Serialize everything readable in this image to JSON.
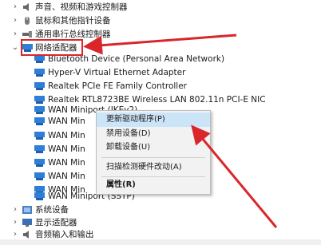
{
  "tree": {
    "top_items": [
      {
        "label": "声音、视频和游戏控制器",
        "icon": "speaker-icon"
      },
      {
        "label": "鼠标和其他指针设备",
        "icon": "mouse-icon"
      },
      {
        "label": "通用串行总线控制器",
        "icon": "usb-icon"
      }
    ],
    "network_adapters": {
      "label": "网络适配器",
      "children": [
        "Bluetooth Device (Personal Area Network)",
        "Hyper-V Virtual Ethernet Adapter",
        "Realtek PCIe FE Family Controller",
        "Realtek RTL8723BE Wireless LAN 802.11n PCI-E NIC",
        "WAN Miniport (IKEv2)",
        "WAN Min",
        "WAN Min",
        "WAN Min",
        "WAN Min",
        "WAN Min",
        "WAN Min",
        "WAN Miniport (SSTP)"
      ]
    },
    "bottom_items": [
      {
        "label": "系统设备",
        "icon": "system-icon"
      },
      {
        "label": "显示适配器",
        "icon": "display-icon"
      },
      {
        "label": "音频输入和输出",
        "icon": "audio-io-icon"
      }
    ]
  },
  "context_menu": {
    "items": [
      "更新驱动程序(P)",
      "禁用设备(D)",
      "卸载设备(U)",
      "扫描检测硬件改动(A)",
      "属性(R)"
    ]
  },
  "colors": {
    "annotation_red": "#d9262b",
    "menu_selected": "#cce4f7",
    "network_icon": "#2f7fd6"
  }
}
